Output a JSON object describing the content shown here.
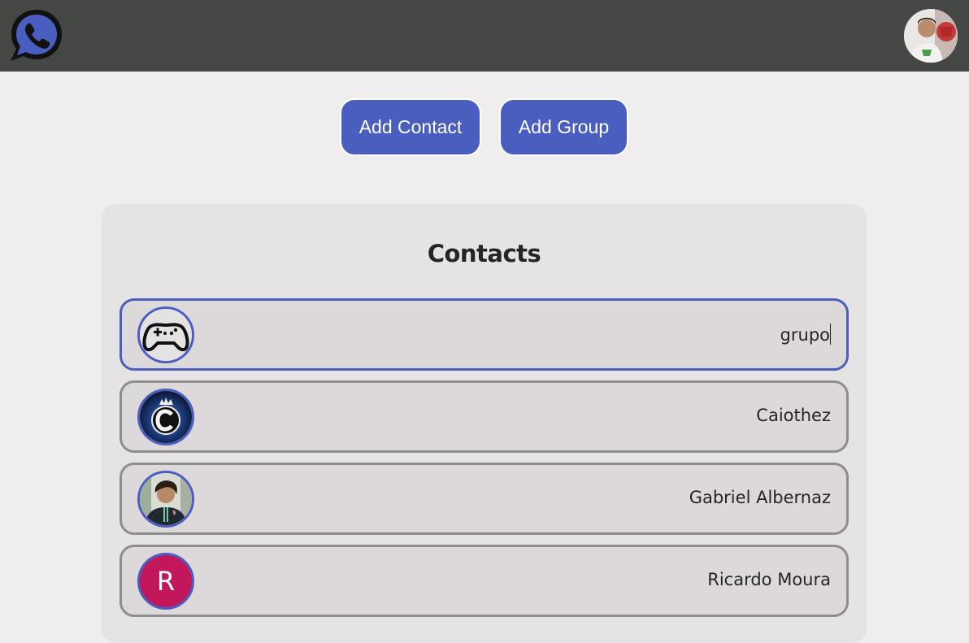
{
  "header": {
    "logo_icon": "phone-chat-icon",
    "profile_icon": "user-photo-avatar"
  },
  "actions": {
    "add_contact_label": "Add Contact",
    "add_group_label": "Add Group"
  },
  "contacts": {
    "title": "Contacts",
    "items": [
      {
        "name": "grupo",
        "avatar_icon": "gamepad-icon",
        "active": true
      },
      {
        "name": "Caiothez",
        "avatar_icon": "c-logo-avatar",
        "active": false
      },
      {
        "name": "Gabriel Albernaz",
        "avatar_icon": "photo-avatar",
        "active": false
      },
      {
        "name": "Ricardo Moura",
        "avatar_letter": "R",
        "avatar_color": "#c2185b",
        "active": false
      }
    ]
  },
  "colors": {
    "accent": "#4a5ec0",
    "topbar": "#454745",
    "background": "#efedee"
  }
}
